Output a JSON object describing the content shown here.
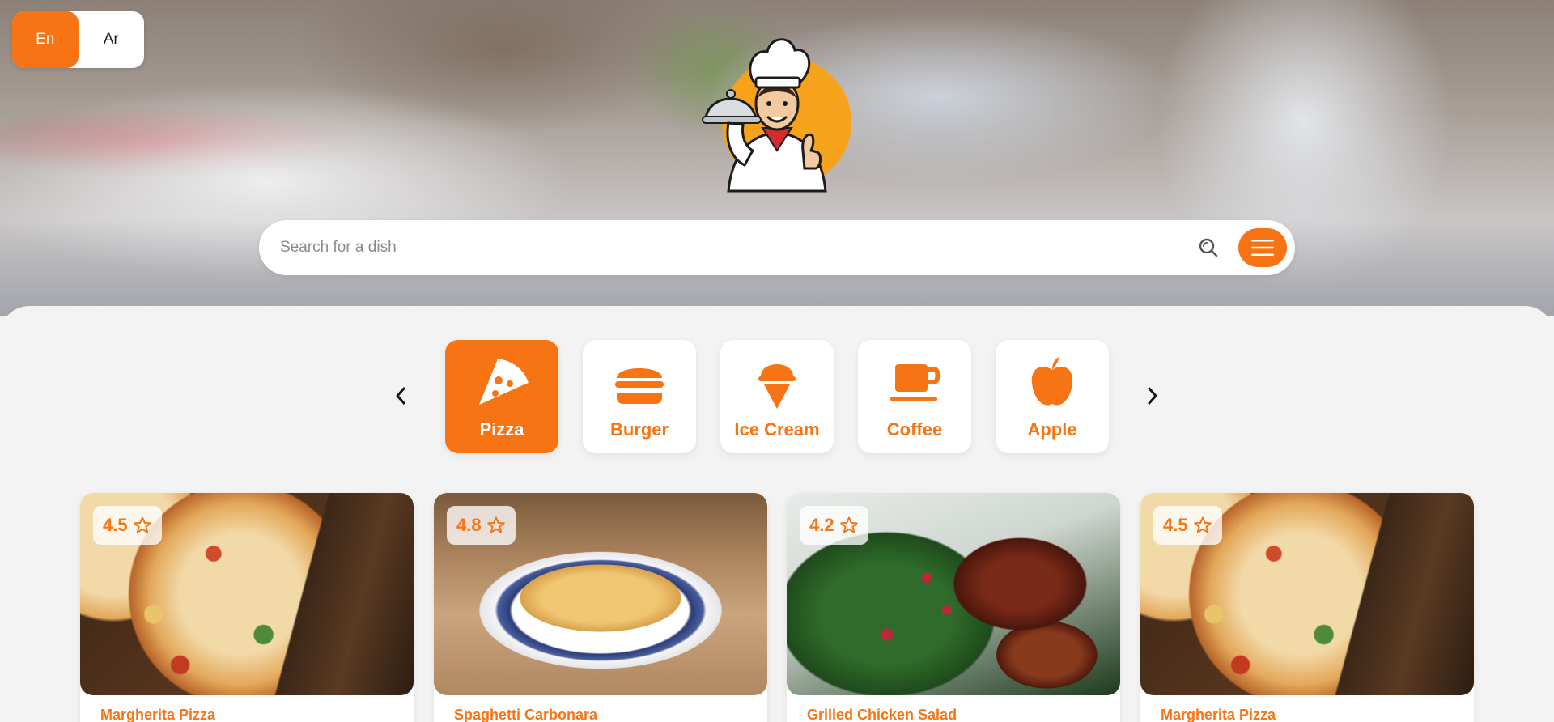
{
  "language_toggle": {
    "options": [
      {
        "label": "En",
        "active": true
      },
      {
        "label": "Ar",
        "active": false
      }
    ]
  },
  "search": {
    "placeholder": "Search for a dish",
    "value": ""
  },
  "icons": {
    "search": "search-icon",
    "menu": "hamburger-menu-icon",
    "prev": "chevron-left-icon",
    "next": "chevron-right-icon",
    "rating": "star-outline-icon"
  },
  "categories": [
    {
      "label": "Pizza",
      "icon": "pizza-icon",
      "active": true
    },
    {
      "label": "Burger",
      "icon": "burger-icon",
      "active": false
    },
    {
      "label": "Ice Cream",
      "icon": "ice-cream-icon",
      "active": false
    },
    {
      "label": "Coffee",
      "icon": "coffee-icon",
      "active": false
    },
    {
      "label": "Apple",
      "icon": "apple-icon",
      "active": false
    }
  ],
  "dishes": [
    {
      "name": "Margherita Pizza",
      "rating": "4.5"
    },
    {
      "name": "Spaghetti Carbonara",
      "rating": "4.8"
    },
    {
      "name": "Grilled Chicken Salad",
      "rating": "4.2"
    },
    {
      "name": "Margherita Pizza",
      "rating": "4.5"
    }
  ],
  "colors": {
    "accent": "#f77414",
    "background": "#f3f3f3",
    "card": "#ffffff"
  }
}
